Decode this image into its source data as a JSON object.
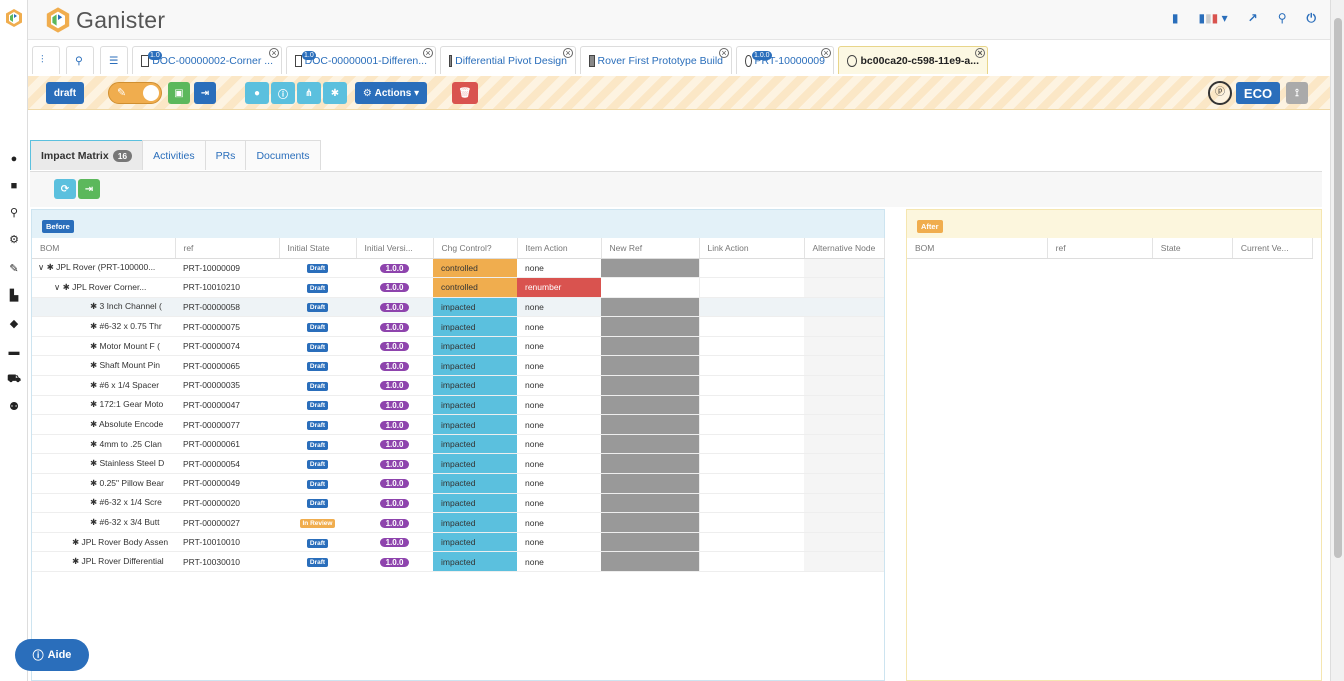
{
  "app": {
    "name": "Ganister"
  },
  "colors": {
    "primary": "#2a6ebb",
    "warning": "#f0ad4e",
    "info": "#5bc0de",
    "danger": "#d9534f",
    "success": "#5cb85c",
    "version": "#8e44ad"
  },
  "sidebar": {
    "icons": [
      "user-icon",
      "file-icon",
      "search-icon",
      "gears-icon",
      "pencil-icon",
      "chart-icon",
      "tag-icon",
      "folder-icon",
      "cart-icon",
      "users-icon"
    ]
  },
  "topbar": {
    "icons": [
      "book-icon",
      "flag-fr-icon",
      "external-link-icon",
      "search-icon",
      "power-icon"
    ]
  },
  "tabs": [
    {
      "label": "DOC-00000002-Corner ...",
      "badge": "1.0"
    },
    {
      "label": "DOC-00000001-Differen...",
      "badge": "1.0"
    },
    {
      "label": "Differential Pivot Design"
    },
    {
      "label": "Rover First Prototype Build"
    },
    {
      "label": "PRT-10000009",
      "badge": "1.0.0"
    },
    {
      "label": "bc00ca20-c598-11e9-a..."
    }
  ],
  "toolbar": {
    "draft": "draft",
    "actions": "Actions",
    "eco": "ECO"
  },
  "page_tabs": [
    {
      "label": "Impact Matrix",
      "count": "16"
    },
    {
      "label": "Activities"
    },
    {
      "label": "PRs"
    },
    {
      "label": "Documents"
    }
  ],
  "before": {
    "label": "Before",
    "columns": [
      "BOM",
      "ref",
      "Initial State",
      "Initial Versi...",
      "Chg Control?",
      "Item Action",
      "New Ref",
      "Link Action",
      "Alternative Node"
    ],
    "rows": [
      {
        "bom": "JPL Rover (PRT-100000...",
        "ref": "PRT-10000009",
        "state": "Draft",
        "ver": "1.0.0",
        "chg": "controlled",
        "action": "none",
        "lvl": 0
      },
      {
        "bom": "JPL Rover Corner...",
        "ref": "PRT-10010210",
        "state": "Draft",
        "ver": "1.0.0",
        "chg": "controlled",
        "action": "renumber",
        "lvl": 1
      },
      {
        "bom": "3 Inch Channel (",
        "ref": "PRT-00000058",
        "state": "Draft",
        "ver": "1.0.0",
        "chg": "impacted",
        "action": "none",
        "lvl": 2
      },
      {
        "bom": "#6-32 x 0.75 Thr",
        "ref": "PRT-00000075",
        "state": "Draft",
        "ver": "1.0.0",
        "chg": "impacted",
        "action": "none",
        "lvl": 2
      },
      {
        "bom": "Motor Mount F (",
        "ref": "PRT-00000074",
        "state": "Draft",
        "ver": "1.0.0",
        "chg": "impacted",
        "action": "none",
        "lvl": 2
      },
      {
        "bom": "Shaft Mount Pin",
        "ref": "PRT-00000065",
        "state": "Draft",
        "ver": "1.0.0",
        "chg": "impacted",
        "action": "none",
        "lvl": 2
      },
      {
        "bom": "#6 x 1/4 Spacer",
        "ref": "PRT-00000035",
        "state": "Draft",
        "ver": "1.0.0",
        "chg": "impacted",
        "action": "none",
        "lvl": 2
      },
      {
        "bom": "172:1 Gear Moto",
        "ref": "PRT-00000047",
        "state": "Draft",
        "ver": "1.0.0",
        "chg": "impacted",
        "action": "none",
        "lvl": 2
      },
      {
        "bom": "Absolute Encode",
        "ref": "PRT-00000077",
        "state": "Draft",
        "ver": "1.0.0",
        "chg": "impacted",
        "action": "none",
        "lvl": 2
      },
      {
        "bom": "4mm to .25 Clan",
        "ref": "PRT-00000061",
        "state": "Draft",
        "ver": "1.0.0",
        "chg": "impacted",
        "action": "none",
        "lvl": 2
      },
      {
        "bom": "Stainless Steel D",
        "ref": "PRT-00000054",
        "state": "Draft",
        "ver": "1.0.0",
        "chg": "impacted",
        "action": "none",
        "lvl": 2
      },
      {
        "bom": "0.25\" Pillow Bear",
        "ref": "PRT-00000049",
        "state": "Draft",
        "ver": "1.0.0",
        "chg": "impacted",
        "action": "none",
        "lvl": 2
      },
      {
        "bom": "#6-32 x 1/4 Scre",
        "ref": "PRT-00000020",
        "state": "Draft",
        "ver": "1.0.0",
        "chg": "impacted",
        "action": "none",
        "lvl": 2
      },
      {
        "bom": "#6-32 x 3/4 Butt",
        "ref": "PRT-00000027",
        "state": "In Review",
        "ver": "1.0.0",
        "chg": "impacted",
        "action": "none",
        "lvl": 2
      },
      {
        "bom": "JPL Rover Body Assen",
        "ref": "PRT-10010010",
        "state": "Draft",
        "ver": "1.0.0",
        "chg": "impacted",
        "action": "none",
        "lvl": 1
      },
      {
        "bom": "JPL Rover Differential",
        "ref": "PRT-10030010",
        "state": "Draft",
        "ver": "1.0.0",
        "chg": "impacted",
        "action": "none",
        "lvl": 1
      }
    ]
  },
  "after": {
    "label": "After",
    "columns": [
      "BOM",
      "ref",
      "State",
      "Current Ve..."
    ]
  },
  "help": {
    "label": "Aide"
  }
}
